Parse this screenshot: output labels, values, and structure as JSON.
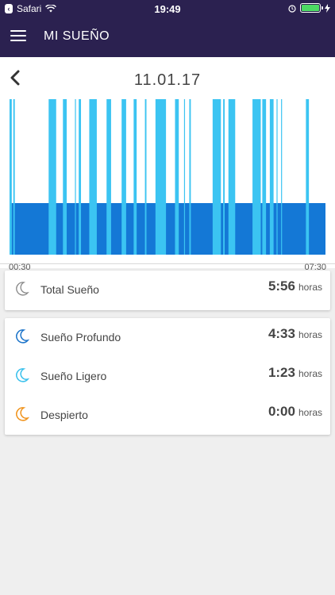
{
  "status_bar": {
    "carrier": "Safari",
    "time": "19:49"
  },
  "header": {
    "title": "MI SUEÑO"
  },
  "date": "11.01.17",
  "chart_data": {
    "type": "bar",
    "x_start": "00:30",
    "x_end": "07:30",
    "series": [
      {
        "name": "Sueño Profundo",
        "color": "#1478d6"
      },
      {
        "name": "Sueño Ligero",
        "color": "#3bc4f2"
      }
    ],
    "light_segments": [
      [
        0,
        3
      ],
      [
        5,
        7
      ],
      [
        52,
        62
      ],
      [
        71,
        76
      ],
      [
        87,
        88
      ],
      [
        92,
        95
      ],
      [
        106,
        116
      ],
      [
        129,
        135
      ],
      [
        149,
        155
      ],
      [
        165,
        169
      ],
      [
        180,
        182
      ],
      [
        194,
        208
      ],
      [
        220,
        225
      ],
      [
        232,
        233
      ],
      [
        239,
        241
      ],
      [
        270,
        281
      ],
      [
        284,
        286
      ],
      [
        291,
        300
      ],
      [
        323,
        334
      ],
      [
        336,
        341
      ],
      [
        346,
        351
      ],
      [
        355,
        356
      ],
      [
        361,
        362
      ],
      [
        394,
        398
      ]
    ],
    "total_minutes": 420
  },
  "summary": {
    "total": {
      "label": "Total Sueño",
      "value": "5:56",
      "unit": "horas"
    }
  },
  "details": [
    {
      "label": "Sueño Profundo",
      "value": "4:33",
      "unit": "horas",
      "icon": "moon-icon",
      "color": "#1a73c9"
    },
    {
      "label": "Sueño Ligero",
      "value": "1:23",
      "unit": "horas",
      "icon": "moon-icon",
      "color": "#38c0ec"
    },
    {
      "label": "Despierto",
      "value": "0:00",
      "unit": "horas",
      "icon": "moon-icon",
      "color": "#f0921a"
    }
  ]
}
